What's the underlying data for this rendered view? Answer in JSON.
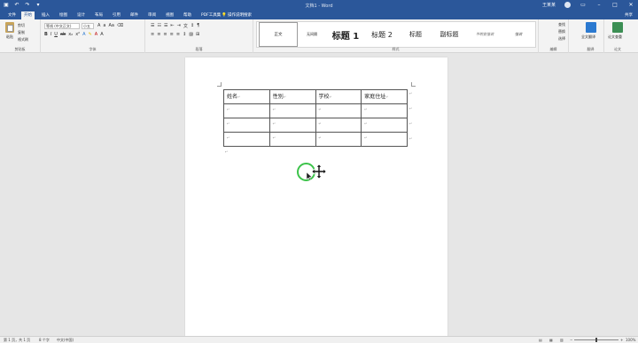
{
  "titlebar": {
    "doc_title": "文档1  -  Word",
    "user": "王某某"
  },
  "tabs": [
    "文件",
    "开始",
    "插入",
    "绘图",
    "设计",
    "布局",
    "引用",
    "邮件",
    "审阅",
    "视图",
    "帮助",
    "PDF工具集"
  ],
  "active_tab": "开始",
  "tell_me": "操作说明搜索",
  "share": "共享",
  "ribbon": {
    "clipboard": {
      "paste": "粘贴",
      "cut": "剪切",
      "copy": "复制",
      "format_painter": "格式刷",
      "label": "剪贴板"
    },
    "font": {
      "name": "等线 (中文正文)",
      "size": "小五",
      "label": "字体"
    },
    "paragraph": {
      "label": "段落"
    },
    "styles": {
      "items": [
        "正文",
        "无间隔",
        "标题 1",
        "标题 2",
        "标题",
        "副标题",
        "不明显强调",
        "强调"
      ],
      "label": "样式"
    },
    "editing": {
      "find": "查找",
      "replace": "替换",
      "select": "选择",
      "label": "编辑"
    },
    "translate": {
      "label": "全文翻译",
      "group": "翻译"
    },
    "paper": {
      "label": "论文查重",
      "group": "论文"
    }
  },
  "table": {
    "headers": [
      "姓名",
      "性别",
      "学校",
      "家庭住址"
    ],
    "rows": [
      [
        "",
        "",
        "",
        ""
      ],
      [
        "",
        "",
        "",
        ""
      ],
      [
        "",
        "",
        "",
        ""
      ]
    ]
  },
  "marks": {
    "cell": "↵",
    "para": "↵"
  },
  "statusbar": {
    "page": "第 1 页，共 1 页",
    "words": "8 个字",
    "lang": "中文(中国)",
    "zoom": "100%"
  },
  "icons": [
    "save-icon",
    "undo-icon",
    "redo-icon",
    "move-cursor-icon",
    "arrow-cursor-icon"
  ]
}
